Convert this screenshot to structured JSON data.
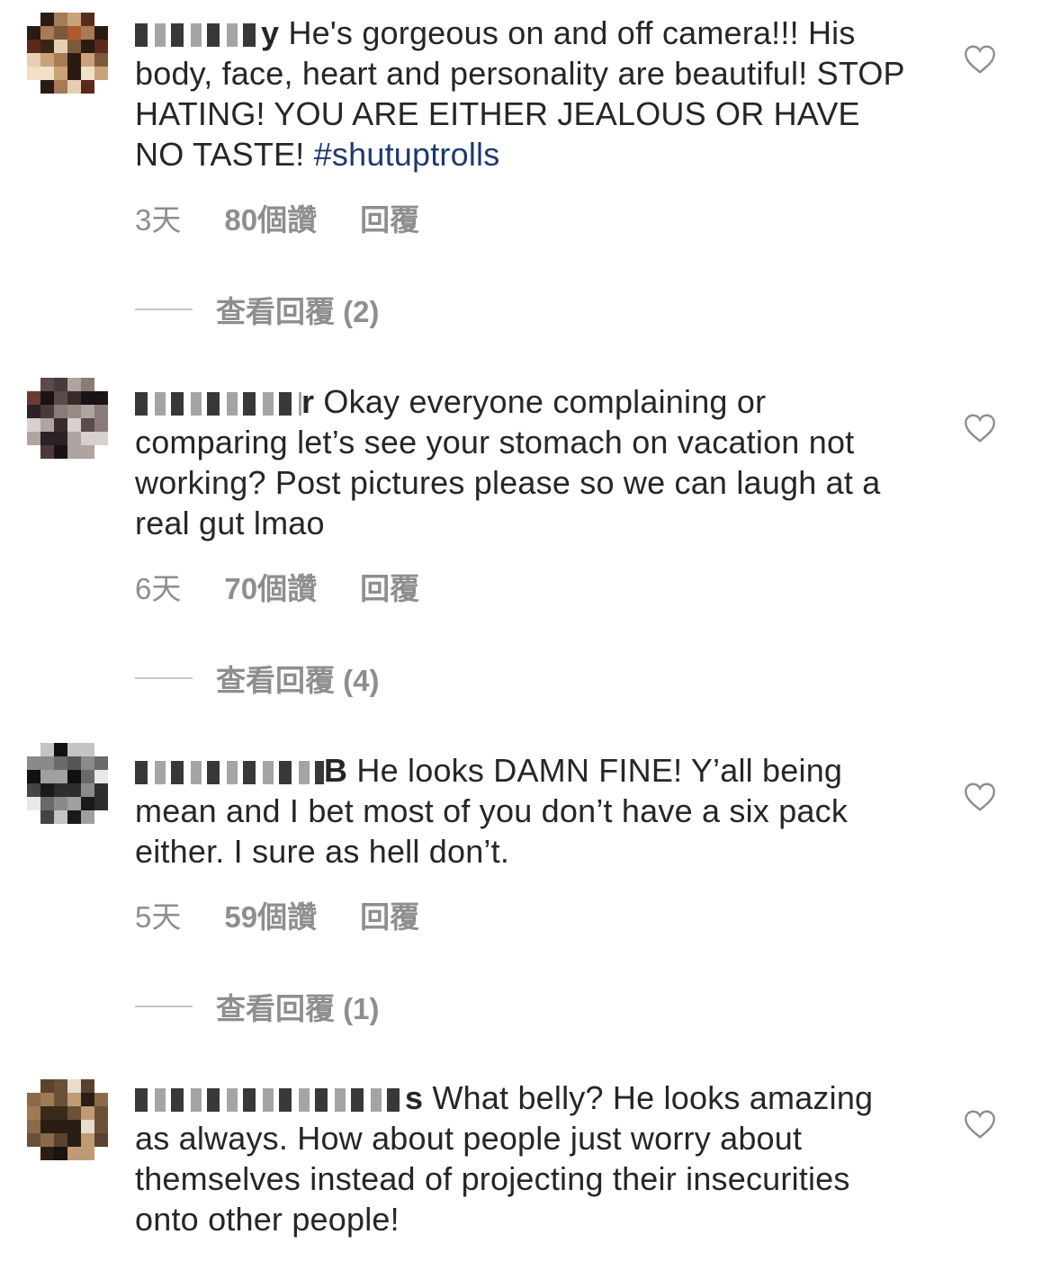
{
  "colors": {
    "text": "#262626",
    "meta": "#8e8e8e",
    "hashtag": "#1e3a70"
  },
  "comments": [
    {
      "username_end": "y",
      "text": "He's gorgeous on and off camera!!! His body, face, heart and personality are beautiful!  STOP HATING! YOU ARE EITHER JEALOUS OR HAVE NO TASTE!",
      "hashtag": "#shutuptrolls",
      "time": "3天",
      "likes": "80個讚",
      "reply": "回覆",
      "view_replies": "查看回覆 (2)",
      "icon": "heart-outline-icon"
    },
    {
      "username_end": "r",
      "text": "Okay everyone complaining or comparing let’s see your stomach on vacation not working? Post pictures please so we can laugh at a real gut lmao",
      "time": "6天",
      "likes": "70個讚",
      "reply": "回覆",
      "view_replies": "查看回覆 (4)",
      "icon": "heart-outline-icon"
    },
    {
      "username_end": "B",
      "text": "He looks DAMN FINE! Y’all being mean and I bet most of you don’t have a six pack either. I sure as hell don’t.",
      "time": "5天",
      "likes": "59個讚",
      "reply": "回覆",
      "view_replies": "查看回覆 (1)",
      "icon": "heart-outline-icon"
    },
    {
      "username_end": "s",
      "text": "What belly? He looks amazing as always. How about people just worry about themselves instead of projecting their insecurities onto other people!",
      "icon": "heart-outline-icon"
    }
  ]
}
